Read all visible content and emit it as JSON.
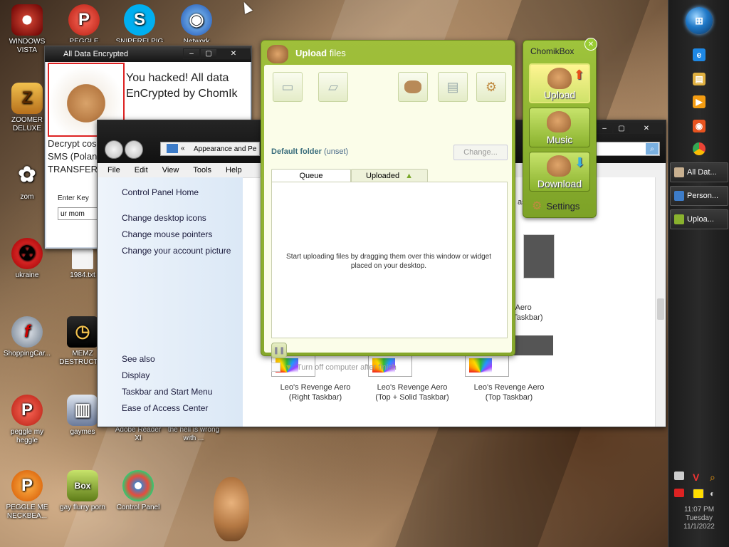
{
  "desktop_icons": [
    {
      "label": "WINDOWS VISTA",
      "icon": "vista-icon",
      "color": "#c0392b"
    },
    {
      "label": "PEGGLE NIGHTS",
      "icon": "peggle-icon",
      "color": "#e74c3c"
    },
    {
      "label": "SNIPERELPIG",
      "icon": "skype-icon",
      "color": "#00aff0"
    },
    {
      "label": "Network",
      "icon": "network-icon",
      "color": "#2a6fd1"
    },
    {
      "label": "ZOOMER DELUXE",
      "icon": "zuma-icon",
      "color": "#e09b1c"
    },
    {
      "label": "zom",
      "icon": "flower-icon",
      "color": "#eeeeee"
    },
    {
      "label": "ukraine",
      "icon": "radiation-icon",
      "color": "#cc1111"
    },
    {
      "label": "1984.txt",
      "icon": "text-file-icon",
      "color": "#f0f0f0"
    },
    {
      "label": "ShoppingCar...",
      "icon": "flash-icon",
      "color": "#9aa4b0"
    },
    {
      "label": "MEMZ DESTRUCTI...",
      "icon": "clock-icon",
      "color": "#c78a2a"
    },
    {
      "label": "peggle my heggle",
      "icon": "peggle-icon",
      "color": "#e74c3c"
    },
    {
      "label": "gaymes",
      "icon": "folder-icon",
      "color": "#6a7a9a"
    },
    {
      "label": "Adobe Reader XI",
      "icon": "adobe-icon",
      "color": "#b30b00"
    },
    {
      "label": "the hell is wrong with ...",
      "icon": "file-icon",
      "color": "#dddddd"
    },
    {
      "label": "PEGGLE ME NECKBEA...",
      "icon": "peggle-icon",
      "color": "#e74c3c"
    },
    {
      "label": "gay flurry porn",
      "icon": "chomikbox-icon",
      "color": "#8ab22e"
    },
    {
      "label": "Control Panel",
      "icon": "control-panel-icon",
      "color": "#4a7fc1"
    }
  ],
  "taskbar": {
    "start": "start-orb",
    "quicklaunch": [
      {
        "icon": "ie-icon",
        "color": "#1e88e5",
        "glyph": "e"
      },
      {
        "icon": "explorer-icon",
        "color": "#e0b040",
        "glyph": "▤"
      },
      {
        "icon": "media-player-icon",
        "color": "#f39c12",
        "glyph": "▶"
      },
      {
        "icon": "weibo-icon",
        "color": "#e8531f",
        "glyph": "◉"
      },
      {
        "icon": "chrome-icon",
        "color": "#34a853",
        "glyph": "◎"
      }
    ],
    "buttons": [
      {
        "label": "All Dat...",
        "icon": "hamster-app-icon",
        "color": "#c8b090"
      },
      {
        "label": "Person...",
        "icon": "personalize-icon",
        "color": "#3d7cc8"
      },
      {
        "label": "Uploa...",
        "icon": "chomikbox-icon",
        "color": "#8ab22e"
      }
    ],
    "clock": {
      "time": "11:07 PM",
      "day": "Tuesday",
      "date": "11/1/2022"
    }
  },
  "ransom": {
    "title": "All Data Encrypted",
    "headline": "You hacked! All data EnCrypted by ChomIk",
    "body_lines": [
      "Decrypt cos",
      "SMS (Polan",
      "TRANSFER"
    ],
    "enter_key_label": "Enter Key",
    "key_value": "ur mom"
  },
  "control_panel": {
    "address": "Appearance and Pe",
    "address_prefix": "«",
    "menu": [
      "File",
      "Edit",
      "View",
      "Tools",
      "Help"
    ],
    "left_links": [
      "Control Panel Home",
      "Change desktop icons",
      "Change mouse pointers",
      "Change your account picture"
    ],
    "see_also_title": "See also",
    "see_also": [
      "Display",
      "Taskbar and Start Menu",
      "Ease of Access Center"
    ],
    "themes_top": [
      {
        "line1": "as"
      },
      {
        "line1": "e Aero",
        "line2": "l Taskbar)"
      }
    ],
    "themes": [
      {
        "line1": "Leo's Revenge Aero",
        "line2": "(Right Taskbar)"
      },
      {
        "line1": "Leo's Revenge Aero",
        "line2": "(Top + Solid Taskbar)"
      },
      {
        "line1": "Leo's Revenge Aero",
        "line2": "(Top Taskbar)"
      }
    ]
  },
  "upload": {
    "title_bold": "Upload",
    "title_rest": "files",
    "default_folder_label": "Default folder",
    "default_folder_value": "(unset)",
    "change_label": "Change...",
    "tabs": [
      "Queue",
      "Uploaded"
    ],
    "queue_message": "Start uploading files by dragging them over this window or widget placed on your desktop.",
    "shutdown_label": "Turn off computer after finish"
  },
  "widget": {
    "title": "ChomikBox",
    "buttons": [
      "Upload",
      "Music",
      "Download"
    ],
    "settings": "Settings"
  }
}
